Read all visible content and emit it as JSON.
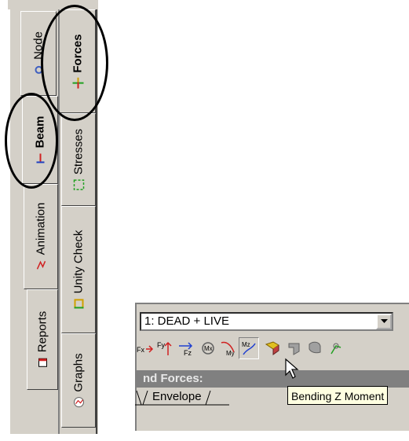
{
  "tabs_outer": [
    {
      "label": "Node",
      "icon": "node-icon"
    },
    {
      "label": "Beam",
      "icon": "beam-icon"
    },
    {
      "label": "Animation",
      "icon": "animation-icon"
    },
    {
      "label": "Reports",
      "icon": "reports-icon"
    }
  ],
  "tabs_inner": [
    {
      "label": "Forces",
      "icon": "forces-icon"
    },
    {
      "label": "Stresses",
      "icon": "stresses-icon"
    },
    {
      "label": "Unity Check",
      "icon": "unity-check-icon"
    },
    {
      "label": "Graphs",
      "icon": "graphs-icon"
    }
  ],
  "toolbar": {
    "combo_value": "1: DEAD + LIVE",
    "icons": [
      "fx-icon",
      "fy-icon",
      "fz-icon",
      "mx-icon",
      "my-icon",
      "mz-icon",
      "shape-icon-1",
      "shape-icon-2",
      "shape-icon-3",
      "shape-icon-4"
    ],
    "section_title": "nd Forces:",
    "tab_label": "Envelope",
    "tooltip": "Bending Z Moment"
  },
  "colors": {
    "face": "#d4d0c8",
    "shadow": "#808080",
    "tooltip_bg": "#ffffe1"
  }
}
